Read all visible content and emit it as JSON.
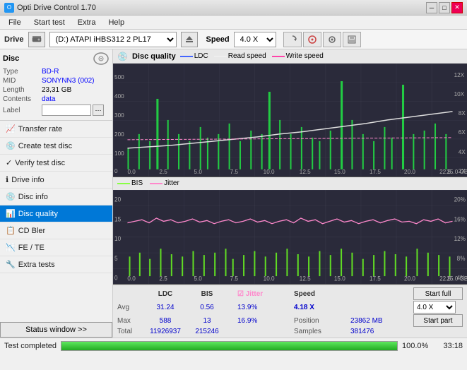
{
  "titleBar": {
    "title": "Opti Drive Control 1.70",
    "minBtn": "─",
    "maxBtn": "□",
    "closeBtn": "✕"
  },
  "menuBar": {
    "items": [
      "File",
      "Start test",
      "Extra",
      "Help"
    ]
  },
  "driveBar": {
    "label": "Drive",
    "driveValue": "(D:) ATAPI iHBS312  2 PL17",
    "speedLabel": "Speed",
    "speedValue": "4.0 X"
  },
  "disc": {
    "title": "Disc",
    "typeLabel": "Type",
    "typeValue": "BD-R",
    "midLabel": "MID",
    "midValue": "SONYNN3 (002)",
    "lengthLabel": "Length",
    "lengthValue": "23,31 GB",
    "contentsLabel": "Contents",
    "contentsValue": "data",
    "labelLabel": "Label",
    "labelValue": ""
  },
  "nav": {
    "items": [
      {
        "id": "transfer-rate",
        "label": "Transfer rate",
        "icon": "📈"
      },
      {
        "id": "create-test-disc",
        "label": "Create test disc",
        "icon": "💿"
      },
      {
        "id": "verify-test-disc",
        "label": "Verify test disc",
        "icon": "✓"
      },
      {
        "id": "drive-info",
        "label": "Drive info",
        "icon": "ℹ"
      },
      {
        "id": "disc-info",
        "label": "Disc info",
        "icon": "💿"
      },
      {
        "id": "disc-quality",
        "label": "Disc quality",
        "icon": "📊",
        "active": true
      },
      {
        "id": "cd-bler",
        "label": "CD Bler",
        "icon": "📋"
      },
      {
        "id": "fe-te",
        "label": "FE / TE",
        "icon": "📉"
      },
      {
        "id": "extra-tests",
        "label": "Extra tests",
        "icon": "🔧"
      }
    ],
    "statusWindow": "Status window >>"
  },
  "chartPanel": {
    "title": "Disc quality",
    "legend1": {
      "ldc": "LDC",
      "readSpeed": "Read speed",
      "writeSpeed": "Write speed"
    },
    "legend2": {
      "bis": "BIS",
      "jitter": "Jitter"
    }
  },
  "stats": {
    "headers": [
      "",
      "LDC",
      "BIS",
      "",
      "Jitter",
      "Speed",
      ""
    ],
    "avgLabel": "Avg",
    "avgLDC": "31.24",
    "avgBIS": "0.56",
    "avgJitter": "13.9%",
    "avgSpeed": "4.18 X",
    "maxLabel": "Max",
    "maxLDC": "588",
    "maxBIS": "13",
    "maxJitter": "16.9%",
    "posLabel": "Position",
    "posValue": "23862 MB",
    "totalLabel": "Total",
    "totalLDC": "11926937",
    "totalBIS": "215246",
    "samplesLabel": "Samples",
    "samplesValue": "381476",
    "startFull": "Start full",
    "startPart": "Start part",
    "speedDropdown": "4.0 X"
  },
  "progress": {
    "statusText": "Test completed",
    "progressPct": "100.0%",
    "fillWidth": "100",
    "timeText": "33:18"
  }
}
